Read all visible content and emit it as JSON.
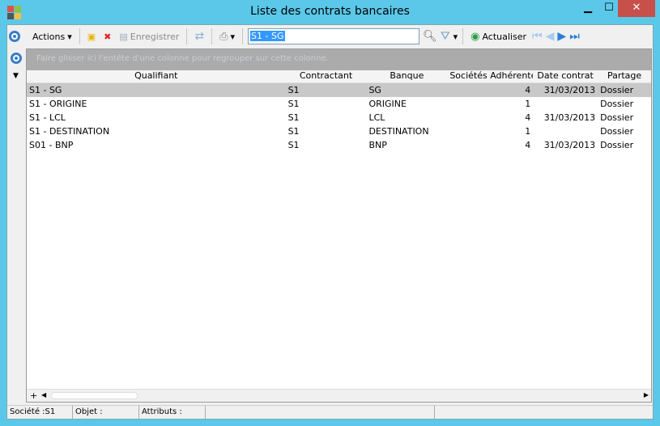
{
  "window": {
    "title": "Liste des contrats bancaires",
    "minimize": "▁",
    "maximize": "☐",
    "close": "✕"
  },
  "toolbar": {
    "actions_label": "Actions",
    "save_label": "Enregistrer",
    "search_value": "S1 - SG",
    "refresh_label": "Actualiser"
  },
  "grid": {
    "group_hint": "Faire glisser ici l'entête d'une colonne pour regrouper sur cette colonne.",
    "columns": [
      "Qualifiant",
      "Contractant",
      "Banque",
      "Sociétés Adhérentes",
      "Date contrat",
      "Partage"
    ],
    "rows": [
      [
        "S1 - SG",
        "S1",
        "SG",
        "4",
        "31/03/2013",
        "Dossier"
      ],
      [
        "S1 - ORIGINE",
        "S1",
        "ORIGINE",
        "1",
        "",
        "Dossier"
      ],
      [
        "S1 - LCL",
        "S1",
        "LCL",
        "4",
        "31/03/2013",
        "Dossier"
      ],
      [
        "S1 - DESTINATION",
        "S1",
        "DESTINATION",
        "1",
        "",
        "Dossier"
      ],
      [
        "S01 - BNP",
        "S1",
        "BNP",
        "4",
        "31/03/2013",
        "Dossier"
      ]
    ]
  },
  "status": {
    "societe": "Société :S1",
    "objet": "Objet :",
    "attributs": "Attributs :"
  }
}
